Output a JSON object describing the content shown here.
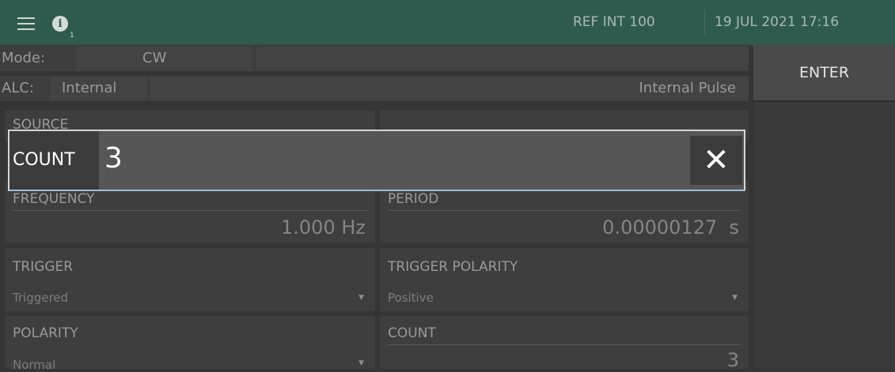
{
  "header": {
    "info_subscript": "1",
    "reference": "REF INT 100",
    "datetime": "19 JUL 2021 17:16"
  },
  "status": {
    "mode_label": "Mode:",
    "mode_value": "CW",
    "alc_label": "ALC:",
    "alc_value": "Internal",
    "pulse_source": "Internal Pulse"
  },
  "side": {
    "enter_label": "ENTER"
  },
  "tiles": {
    "source_label": "SOURCE",
    "frequency_label": "FREQUENCY",
    "frequency_value": "1.000 Hz",
    "period_label": "PERIOD",
    "period_value": "0.00000127  s",
    "trigger_label": "TRIGGER",
    "trigger_value": "Triggered",
    "trigger_polarity_label": "TRIGGER POLARITY",
    "trigger_polarity_value": "Positive",
    "polarity_label": "POLARITY",
    "polarity_value": "Normal",
    "count_label": "COUNT",
    "count_value": "3"
  },
  "entry": {
    "label": "COUNT",
    "value": "3",
    "clear_symbol": "✕"
  }
}
